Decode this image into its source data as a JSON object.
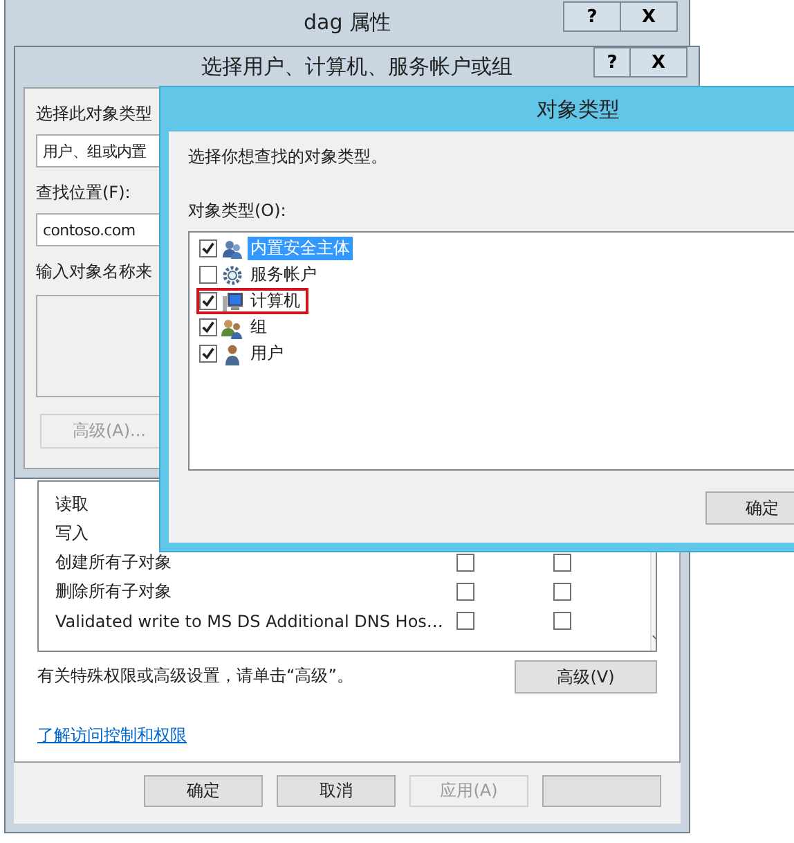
{
  "properties_dialog": {
    "title": "dag 属性",
    "help_button": "?",
    "close_button": "X",
    "permissions": [
      {
        "name": "读取"
      },
      {
        "name": "写入"
      },
      {
        "name": "创建所有子对象",
        "allow": false,
        "deny": false
      },
      {
        "name": "删除所有子对象",
        "allow": false,
        "deny": false
      },
      {
        "name": "Validated write to MS DS Additional DNS Hos…",
        "allow": false,
        "deny": false
      }
    ],
    "advanced_hint": "有关特殊权限或高级设置，请单击“高级”。",
    "advanced_button": "高级(V)",
    "learn_link": "了解访问控制和权限",
    "buttons": [
      {
        "label": "确定",
        "disabled": false
      },
      {
        "label": "取消",
        "disabled": false
      },
      {
        "label": "应用(A)",
        "disabled": true
      }
    ]
  },
  "select_dialog": {
    "title": "选择用户、计算机、服务帐户或组",
    "help_button": "?",
    "close_button": "X",
    "object_type_label": "选择此对象类型",
    "object_type_value": "用户、组或内置",
    "location_label": "查找位置(F):",
    "location_value": "contoso.com",
    "names_label": "输入对象名称来",
    "advanced_button": {
      "label": "高级(A)...",
      "disabled": true
    }
  },
  "types_dialog": {
    "title": "对象类型",
    "prompt": "选择你想查找的对象类型。",
    "list_label": "对象类型(O):",
    "types": [
      {
        "kind": "principal",
        "label": "内置安全主体",
        "checked": true,
        "selected": true,
        "outlined": false
      },
      {
        "kind": "service",
        "label": "服务帐户",
        "checked": false,
        "selected": false,
        "outlined": false
      },
      {
        "kind": "computer",
        "label": "计算机",
        "checked": true,
        "selected": false,
        "outlined": true
      },
      {
        "kind": "group",
        "label": "组",
        "checked": true,
        "selected": false,
        "outlined": false
      },
      {
        "kind": "user",
        "label": "用户",
        "checked": true,
        "selected": false,
        "outlined": false
      }
    ],
    "ok_button": "确定"
  }
}
